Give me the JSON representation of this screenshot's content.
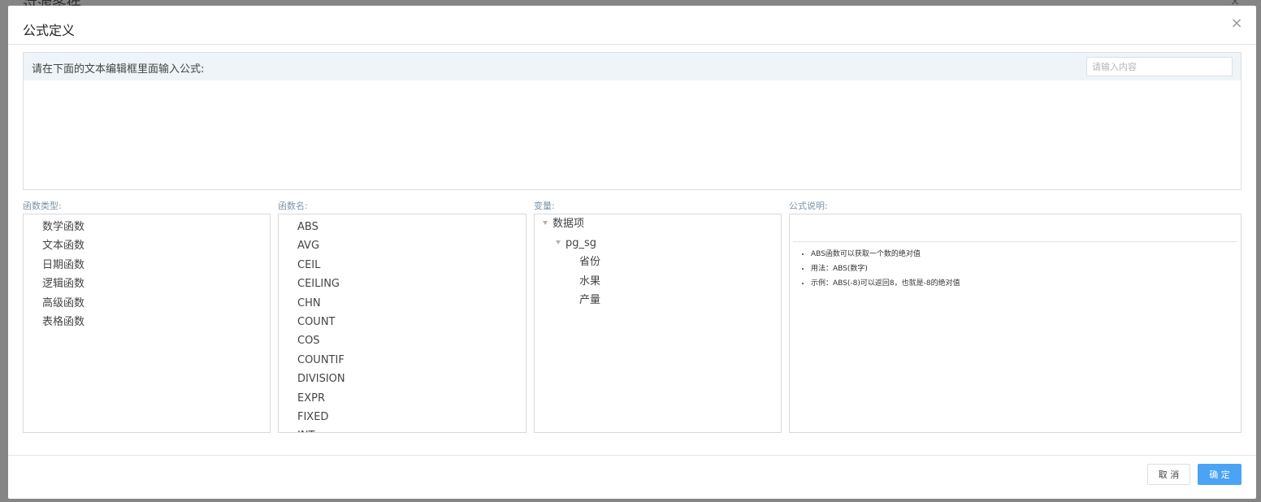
{
  "backdrop": {
    "title": "过滤条件",
    "close_glyph": "×"
  },
  "dialog": {
    "title": "公式定义",
    "close_glyph": "×"
  },
  "editor": {
    "hint": "请在下面的文本编辑框里面输入公式:",
    "search_placeholder": "请输入内容",
    "search_value": "",
    "formula_value": ""
  },
  "panels": {
    "function_types": {
      "label": "函数类型:",
      "items": [
        "数学函数",
        "文本函数",
        "日期函数",
        "逻辑函数",
        "高级函数",
        "表格函数"
      ]
    },
    "function_names": {
      "label": "函数名:",
      "items": [
        "ABS",
        "AVG",
        "CEIL",
        "CEILING",
        "CHN",
        "COUNT",
        "COS",
        "COUNTIF",
        "DIVISION",
        "EXPR",
        "FIXED",
        "INT"
      ]
    },
    "variables": {
      "label": "变量:",
      "root": "数据项",
      "table": "pg_sg",
      "fields": [
        "省份",
        "水果",
        "产量"
      ]
    },
    "description": {
      "label": "公式说明:",
      "lines": [
        "ABS函数可以获取一个数的绝对值",
        "用法：ABS(数字)",
        "示例：ABS(-8)可以返回8，也就是-8的绝对值"
      ]
    }
  },
  "footer": {
    "cancel_label": "取 消",
    "ok_label": "确 定"
  },
  "colors": {
    "primary": "#4aa3f5",
    "editor_bar": "#eef4f7",
    "panel_label": "#7b93a8"
  }
}
